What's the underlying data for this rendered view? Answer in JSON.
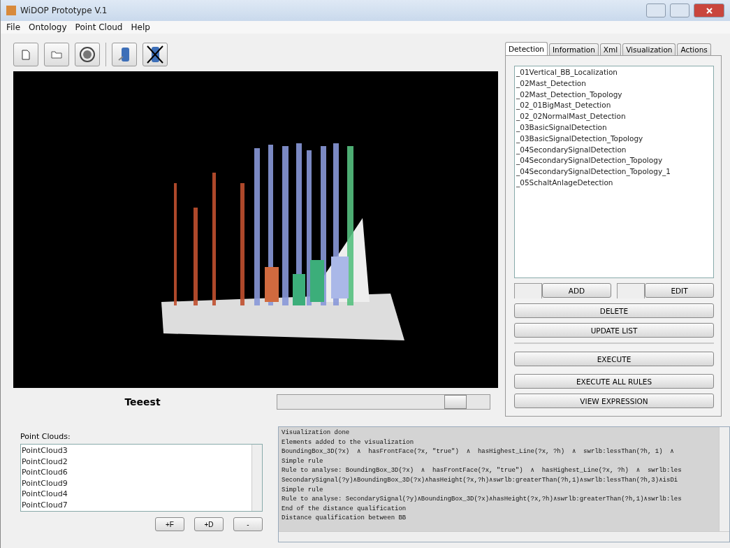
{
  "window": {
    "title": "WiDOP Prototype V.1"
  },
  "menu": [
    "File",
    "Ontology",
    "Point Cloud",
    "Help"
  ],
  "viewer": {
    "caption": "Teeest",
    "slider": {
      "level": 0.86
    }
  },
  "point_clouds": {
    "label": "Point Clouds:",
    "items": [
      "PointCloud3",
      "PointCloud2",
      "PointCloud6",
      "PointCloud9",
      "PointCloud4",
      "PointCloud7"
    ],
    "buttons": [
      "+F",
      "+D",
      "-"
    ]
  },
  "tabs": [
    {
      "label": "Detection",
      "selected": true
    },
    {
      "label": "Information",
      "selected": false
    },
    {
      "label": "Xml",
      "selected": false
    },
    {
      "label": "Visualization",
      "selected": false
    },
    {
      "label": "Actions",
      "selected": false
    }
  ],
  "rules": [
    "_01Vertical_BB_Localization",
    "_02Mast_Detection",
    "_02Mast_Detection_Topology",
    "_02_01BigMast_Detection",
    "_02_02NormalMast_Detection",
    "_03BasicSignalDetection",
    "_03BasicSignalDetection_Topology",
    "_04SecondarySignalDetection",
    "_04SecondarySignalDetection_Topology",
    "_04SecondarySignalDetection_Topology_1",
    "_05SchaltAnlageDetection"
  ],
  "split_buttons": [
    "ADD",
    "EDIT"
  ],
  "buttons": [
    "DELETE",
    "UPDATE LIST"
  ],
  "action_buttons": [
    "EXECUTE",
    "EXECUTE ALL RULES",
    "VIEW EXPRESSION"
  ],
  "log": [
    "Visualization done",
    "Elements added to the visualization",
    "BoundingBox_3D(?x)  ∧  hasFrontFace(?x, \"true\")  ∧  hasHighest_Line(?x, ?h)  ∧  swrlb:lessThan(?h, 1)  ∧",
    "Simple rule",
    "Rule to analyse: BoundingBox_3D(?x)  ∧  hasFrontFace(?x, \"true\")  ∧  hasHighest_Line(?x, ?h)  ∧  swrlb:les",
    "SecondarySignal(?y)∧BoundingBox_3D(?x)∧hasHeight(?x,?h)∧swrlb:greaterThan(?h,1)∧swrlb:lessThan(?h,3)∧isDi",
    "Simple rule",
    "Rule to analyse: SecondarySignal(?y)∧BoundingBox_3D(?x)∧hasHeight(?x,?h)∧swrlb:greaterThan(?h,1)∧swrlb:les",
    "End of the distance qualification",
    "Distance qualification between BB"
  ]
}
